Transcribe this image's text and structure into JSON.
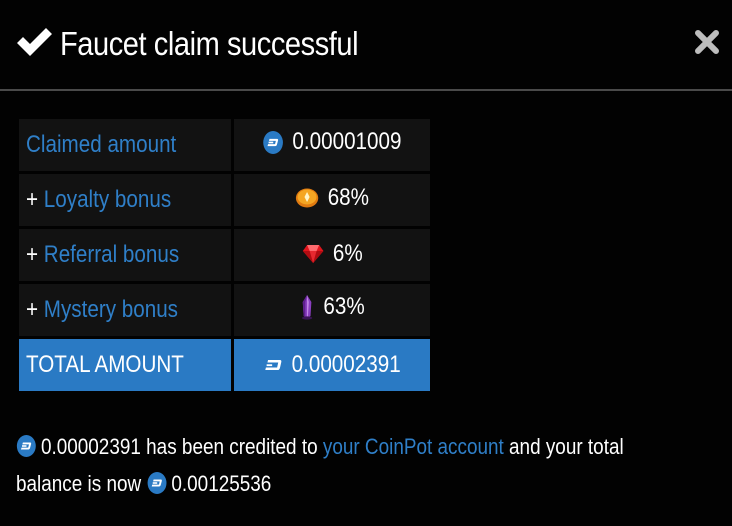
{
  "dialog": {
    "title": "Faucet claim successful",
    "icons": {
      "title": "check-icon",
      "close": "close-x-icon",
      "currency": "dash-coin-icon",
      "loyalty": "gold-coin-icon",
      "referral": "red-gem-icon",
      "mystery": "purple-crystal-icon"
    }
  },
  "table": {
    "rows": [
      {
        "prefix": "",
        "label": "Claimed amount",
        "value": "0.00001009"
      },
      {
        "prefix": "+ ",
        "label": "Loyalty bonus",
        "value": "68%"
      },
      {
        "prefix": "+ ",
        "label": "Referral bonus",
        "value": "6%"
      },
      {
        "prefix": "+ ",
        "label": "Mystery bonus",
        "value": "63%"
      }
    ],
    "total": {
      "label": "TOTAL AMOUNT",
      "value": "0.00002391"
    }
  },
  "footer": {
    "amount": "0.00002391",
    "text_credited": " has been credited to ",
    "link_text": "your CoinPot account",
    "text_balance": " and your total",
    "text_now": "balance is now ",
    "balance": "0.00125536"
  },
  "colors": {
    "background": "#020202",
    "cell": "#121212",
    "accent": "#2a7ac4",
    "link": "#2f7fc8",
    "divider": "#4a4a4a"
  }
}
